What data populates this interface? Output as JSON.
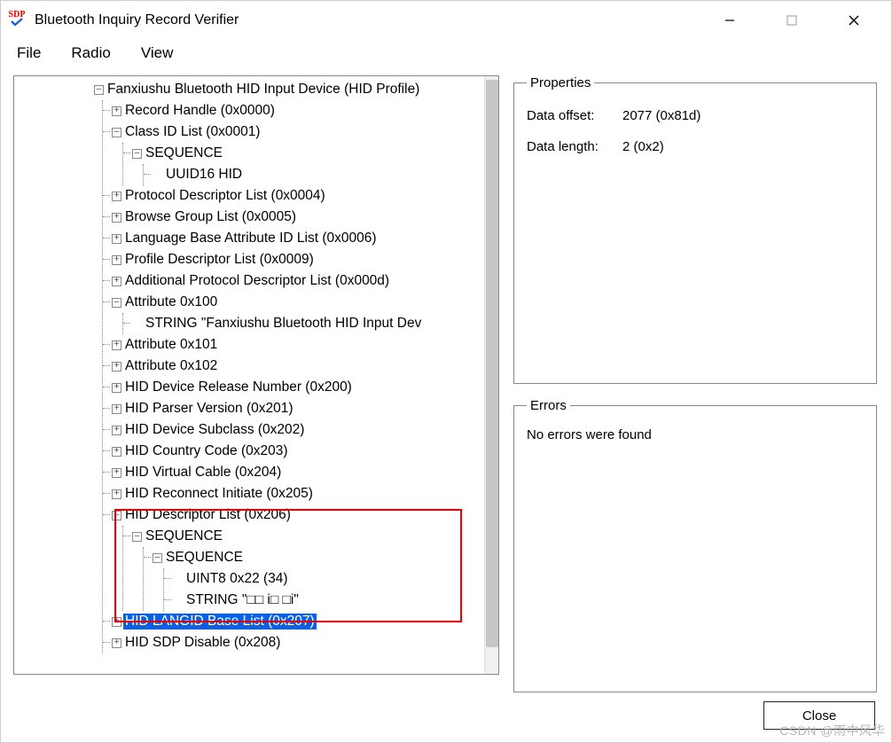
{
  "title": "Bluetooth Inquiry Record Verifier",
  "icon": {
    "text": "SDP"
  },
  "menu": {
    "file": "File",
    "radio": "Radio",
    "view": "View"
  },
  "tree": {
    "root": "Fanxiushu Bluetooth HID Input Device (HID Profile)",
    "recordHandle": "Record Handle (0x0000)",
    "classIdList": "Class ID List (0x0001)",
    "sequence1": "SEQUENCE",
    "uuid16": "UUID16 HID",
    "protocolDescList": "Protocol Descriptor List (0x0004)",
    "browseGroup": "Browse Group List (0x0005)",
    "langBase": "Language Base Attribute ID List (0x0006)",
    "profileDesc": "Profile Descriptor List (0x0009)",
    "addlProtocol": "Additional Protocol Descriptor List (0x000d)",
    "attr100": "Attribute 0x100",
    "attr100str": "STRING \"Fanxiushu Bluetooth HID Input Dev",
    "attr101": "Attribute 0x101",
    "attr102": "Attribute 0x102",
    "devRelease": "HID Device Release Number (0x200)",
    "parserVer": "HID Parser Version (0x201)",
    "devSubclass": "HID Device Subclass (0x202)",
    "countryCode": "HID Country Code (0x203)",
    "virtualCable": "HID Virtual Cable (0x204)",
    "reconnect": "HID Reconnect Initiate (0x205)",
    "descList": "HID Descriptor List (0x206)",
    "seqOuter": "SEQUENCE",
    "seqInner": "SEQUENCE",
    "uint8": "UINT8 0x22 (34)",
    "stringBox": "STRING \"□□ i□ □i\"",
    "langidBase": "HID LANGID Base List (0x207)",
    "sdpDisable": "HID SDP Disable (0x208)"
  },
  "props": {
    "legend": "Properties",
    "offsetLabel": "Data offset:",
    "offsetValue": "2077 (0x81d)",
    "lengthLabel": "Data length:",
    "lengthValue": "2 (0x2)"
  },
  "errors": {
    "legend": "Errors",
    "msg": "No errors were found"
  },
  "closeBtn": "Close",
  "watermark": "CSDN @雨中风华"
}
